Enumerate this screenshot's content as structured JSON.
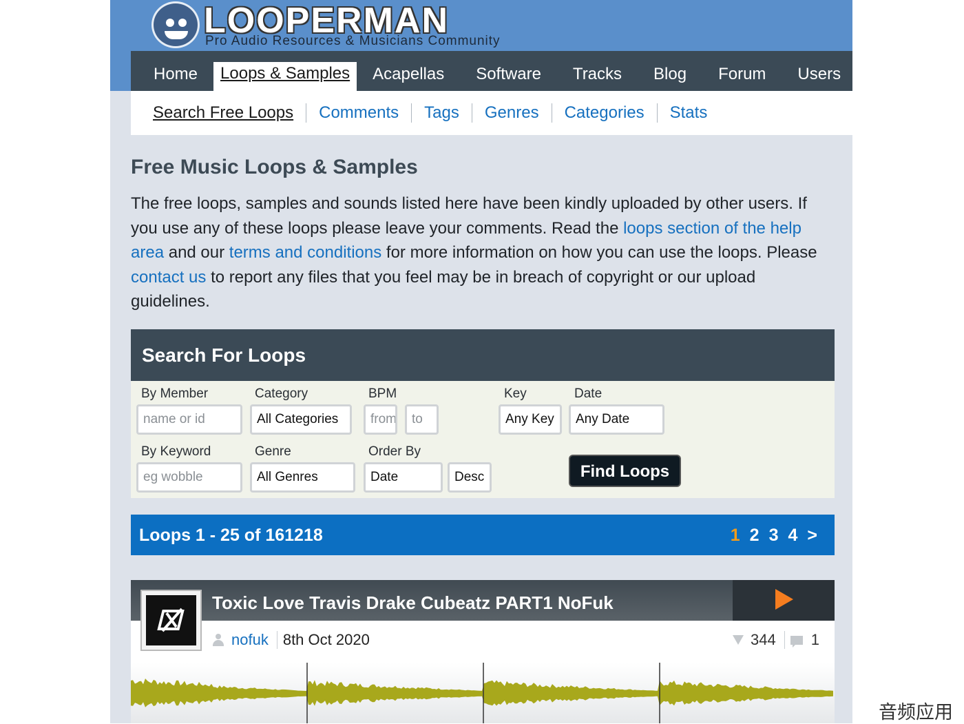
{
  "site": {
    "title": "LOOPERMAN",
    "tagline": "Pro Audio Resources & Musicians Community"
  },
  "main_nav": [
    {
      "label": "Home",
      "active": false
    },
    {
      "label": "Loops & Samples",
      "active": true
    },
    {
      "label": "Acapellas",
      "active": false
    },
    {
      "label": "Software",
      "active": false
    },
    {
      "label": "Tracks",
      "active": false
    },
    {
      "label": "Blog",
      "active": false
    },
    {
      "label": "Forum",
      "active": false
    },
    {
      "label": "Users",
      "active": false
    }
  ],
  "sub_nav": [
    {
      "label": "Search Free Loops",
      "active": true
    },
    {
      "label": "Comments",
      "active": false
    },
    {
      "label": "Tags",
      "active": false
    },
    {
      "label": "Genres",
      "active": false
    },
    {
      "label": "Categories",
      "active": false
    },
    {
      "label": "Stats",
      "active": false
    }
  ],
  "page": {
    "heading": "Free Music Loops & Samples",
    "intro": {
      "t1": "The free loops, samples and sounds listed here have been kindly uploaded by other users. If you use any of these loops please leave your comments. Read the ",
      "link_help": "loops section of the help area",
      "t2": " and our ",
      "link_terms": "terms and conditions",
      "t3": " for more information on how you can use the loops. Please ",
      "link_contact": "contact us",
      "t4": " to report any files that you feel may be in breach of copyright or our upload guidelines."
    }
  },
  "search": {
    "title": "Search For Loops",
    "labels": {
      "member": "By Member",
      "category": "Category",
      "bpm": "BPM",
      "key": "Key",
      "date": "Date",
      "keyword": "By Keyword",
      "genre": "Genre",
      "order_by": "Order By"
    },
    "fields": {
      "member_placeholder": "name or id",
      "category_value": "All Categories",
      "bpm_from_placeholder": "from",
      "bpm_to_placeholder": "to",
      "key_value": "Any Key",
      "date_value": "Any Date",
      "keyword_placeholder": "eg wobble",
      "genre_value": "All Genres",
      "order_value": "Date",
      "direction_value": "Desc"
    },
    "button_label": "Find Loops"
  },
  "results": {
    "summary": "Loops 1 - 25 of 161218",
    "pages": [
      "1",
      "2",
      "3",
      "4",
      ">"
    ],
    "current_page": "1"
  },
  "loop": {
    "title": "Toxic Love Travis Drake Cubeatz PART1 NoFuk",
    "author": "nofuk",
    "date": "8th Oct 2020",
    "downloads": "344",
    "comments": "1"
  },
  "watermark": "音频应用",
  "colors": {
    "header_blue": "#5a8fcb",
    "nav_dark": "#3b4a56",
    "link_blue": "#1670bf",
    "results_bar": "#0c6fc2",
    "current_page": "#f39c1a",
    "play_orange": "#f57d1f",
    "waveform": "#a8a81c"
  }
}
